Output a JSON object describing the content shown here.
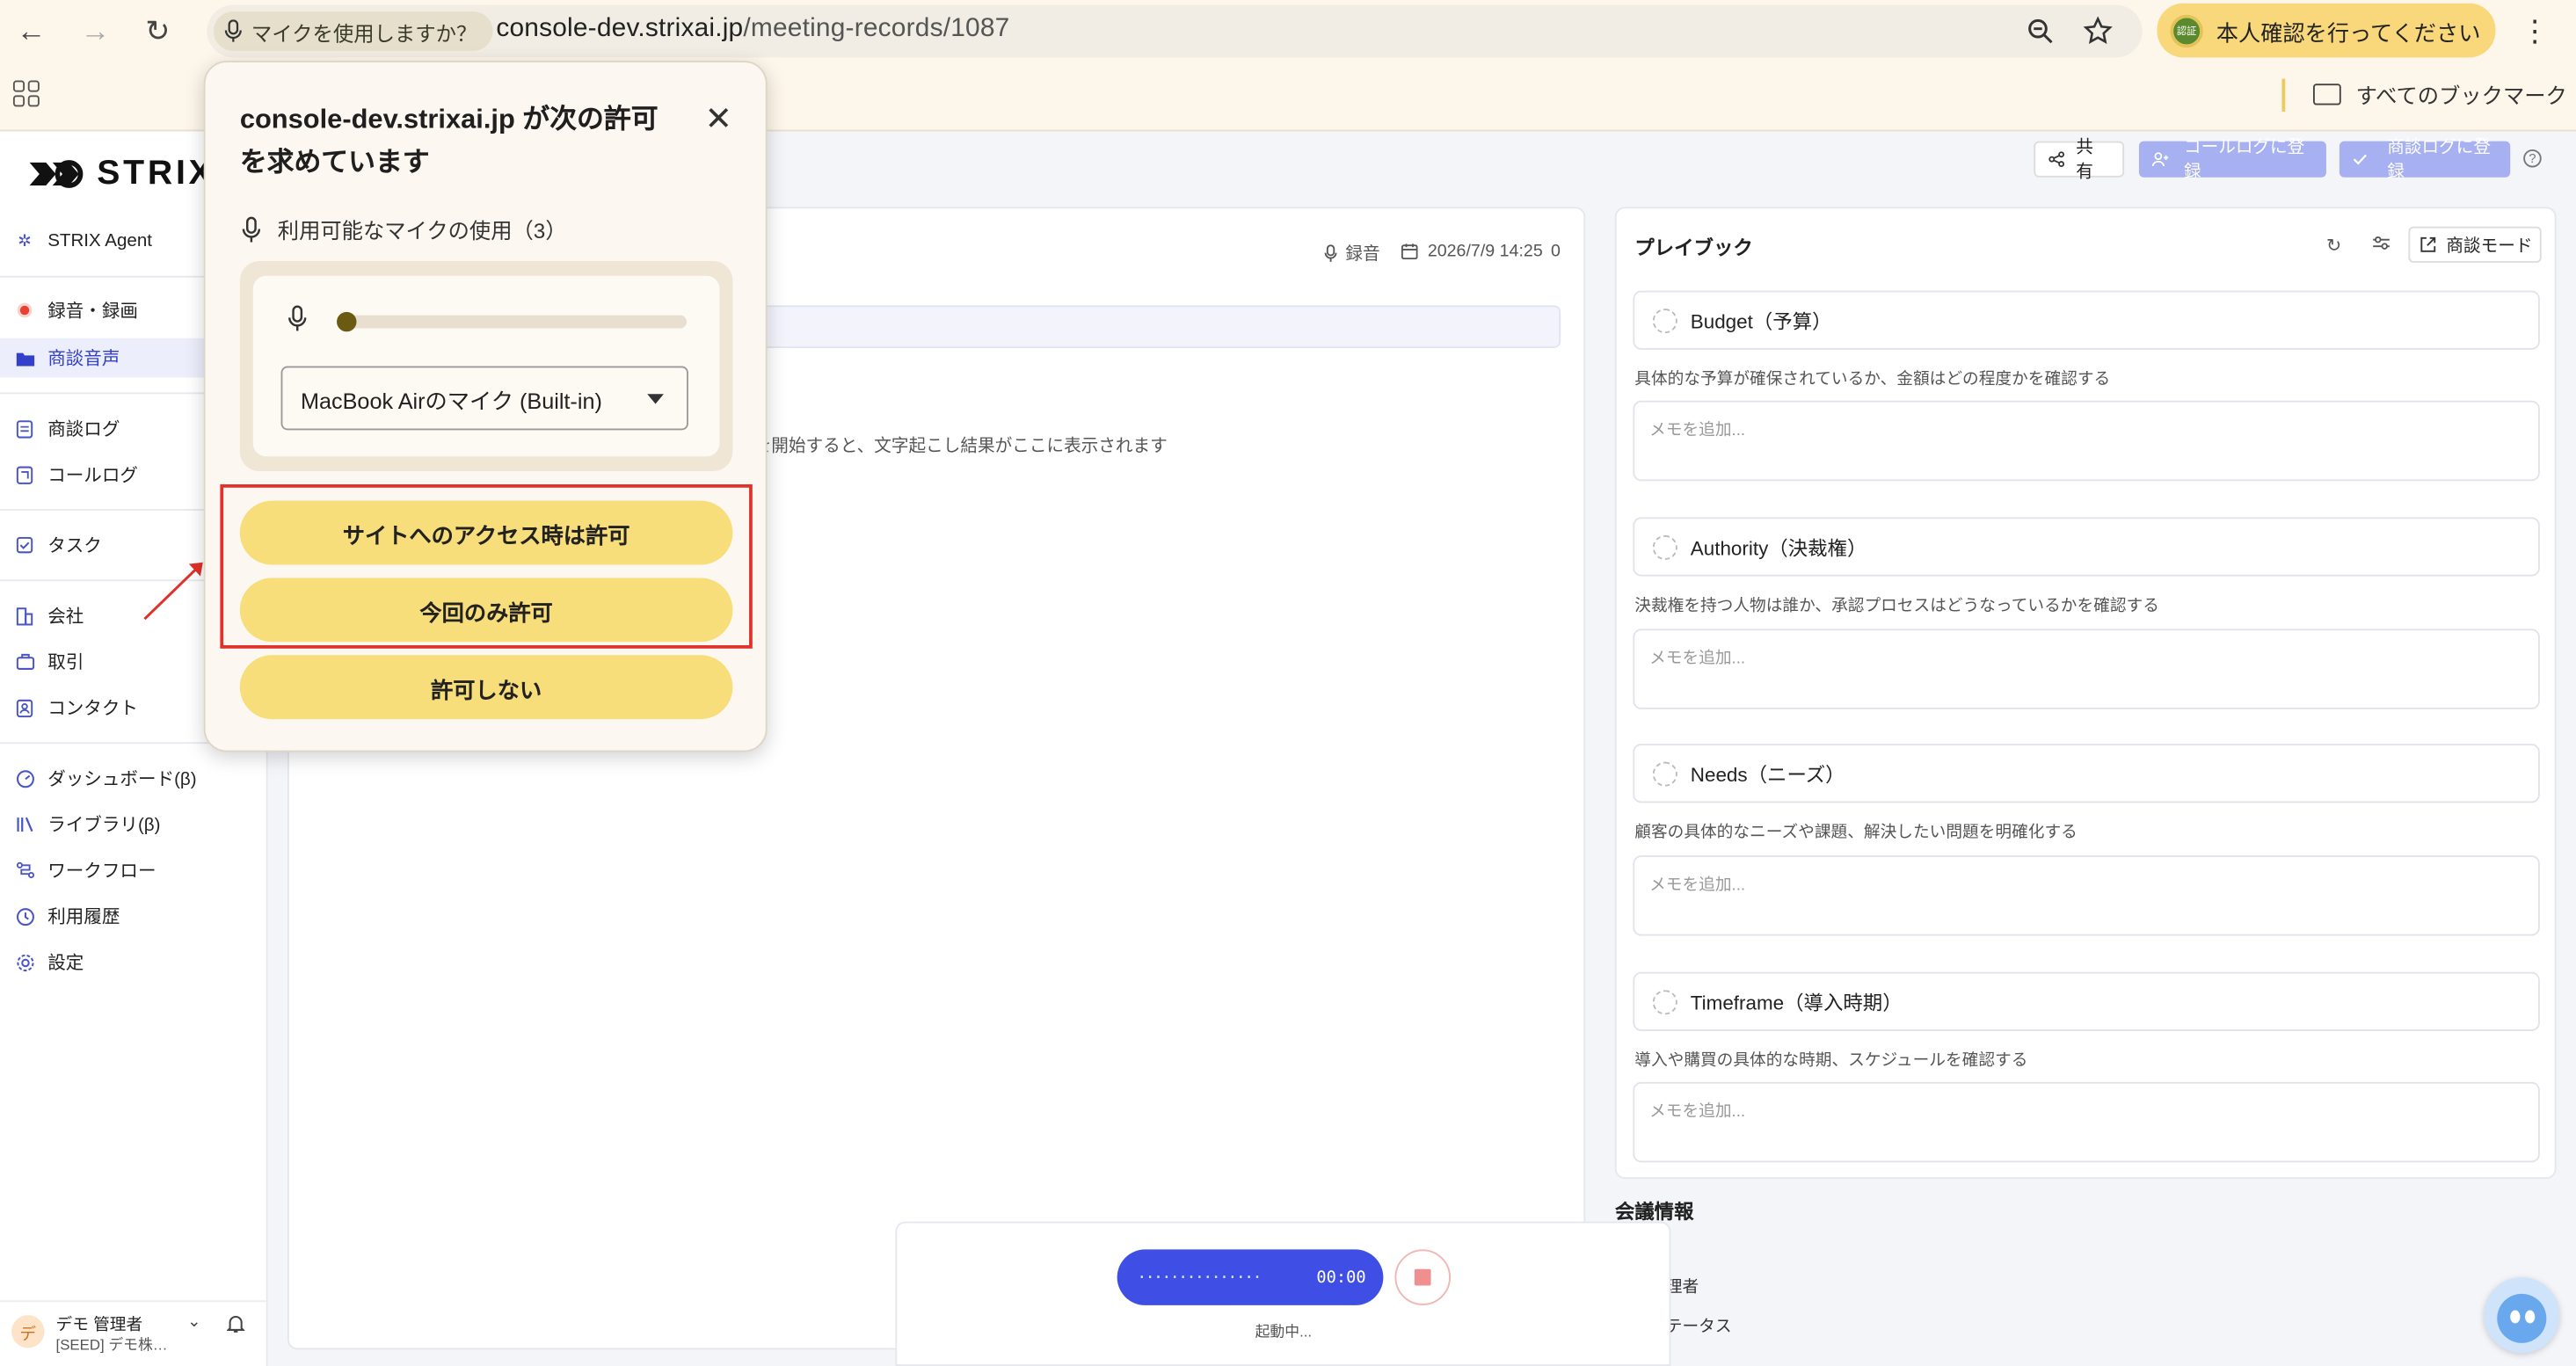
{
  "browser": {
    "permission_chip": "マイクを使用しますか？",
    "url_host": "console-dev.strixai.jp",
    "url_path": "/meeting-records/1087",
    "verify_badge": "認証",
    "verify_label": "本人確認を行ってください",
    "bookmarks_all": "すべてのブックマーク"
  },
  "popup": {
    "title": "console-dev.strixai.jp が次の許可を求めています",
    "mic_usage": "利用可能なマイクの使用（3）",
    "mic_select": "MacBook Airのマイク (Built-in)",
    "mic_level": 0,
    "allow_on_visit": "サイトへのアクセス時は許可",
    "allow_once": "今回のみ許可",
    "deny": "許可しない"
  },
  "app": {
    "logo": "STRIX",
    "sidebar": [
      {
        "label": "STRIX Agent",
        "icon": "sparkle-icon"
      },
      {
        "label": "録音・録画",
        "icon": "record-icon"
      },
      {
        "label": "商談音声",
        "icon": "folder-icon",
        "active": true
      },
      {
        "label": "商談ログ",
        "icon": "document-icon"
      },
      {
        "label": "コールログ",
        "icon": "phone-icon"
      },
      {
        "label": "タスク",
        "icon": "checkbox-icon"
      },
      {
        "label": "会社",
        "icon": "building-icon"
      },
      {
        "label": "取引",
        "icon": "briefcase-icon"
      },
      {
        "label": "コンタクト",
        "icon": "contact-icon"
      },
      {
        "label": "ダッシュボード(β)",
        "icon": "dashboard-icon"
      },
      {
        "label": "ライブラリ(β)",
        "icon": "library-icon"
      },
      {
        "label": "ワークフロー",
        "icon": "workflow-icon"
      },
      {
        "label": "利用履歴",
        "icon": "history-icon"
      },
      {
        "label": "設定",
        "icon": "gear-icon"
      }
    ],
    "user": {
      "initial": "デ",
      "name": "デモ 管理者",
      "org": "[SEED] デモ株式会社"
    },
    "header": {
      "share": "共有",
      "call_log": "コールログに登録",
      "deal_log": "商談ログに登録"
    },
    "record": {
      "type": "録音",
      "datetime": "2026/7/9 14:25",
      "count": "0",
      "hint": "を開始すると、文字起こし結果がここに表示されます"
    },
    "playbook": {
      "title": "プレイブック",
      "mode": "商談モード",
      "criteria": [
        {
          "name": "Budget（予算）",
          "desc": "具体的な予算が確保されているか、金額はどの程度かを確認する",
          "placeholder": "メモを追加..."
        },
        {
          "name": "Authority（決裁権）",
          "desc": "決裁権を持つ人物は誰か、承認プロセスはどうなっているかを確認する",
          "placeholder": "メモを追加..."
        },
        {
          "name": "Needs（ニーズ）",
          "desc": "顧客の具体的なニーズや課題、解決したい問題を明確化する",
          "placeholder": "メモを追加..."
        },
        {
          "name": "Timeframe（導入時期）",
          "desc": "導入や購買の具体的な時期、スケジュールを確認する",
          "placeholder": "メモを追加..."
        }
      ]
    },
    "meeting_info": {
      "title": "会議情報",
      "row1": "理者",
      "row2": "テータス"
    },
    "recorder": {
      "time": "00:00",
      "status": "起動中..."
    }
  },
  "colors": {
    "accent": "#3f4fe5",
    "button_yellow": "#f8de7a",
    "highlight_red": "#e0312a"
  }
}
